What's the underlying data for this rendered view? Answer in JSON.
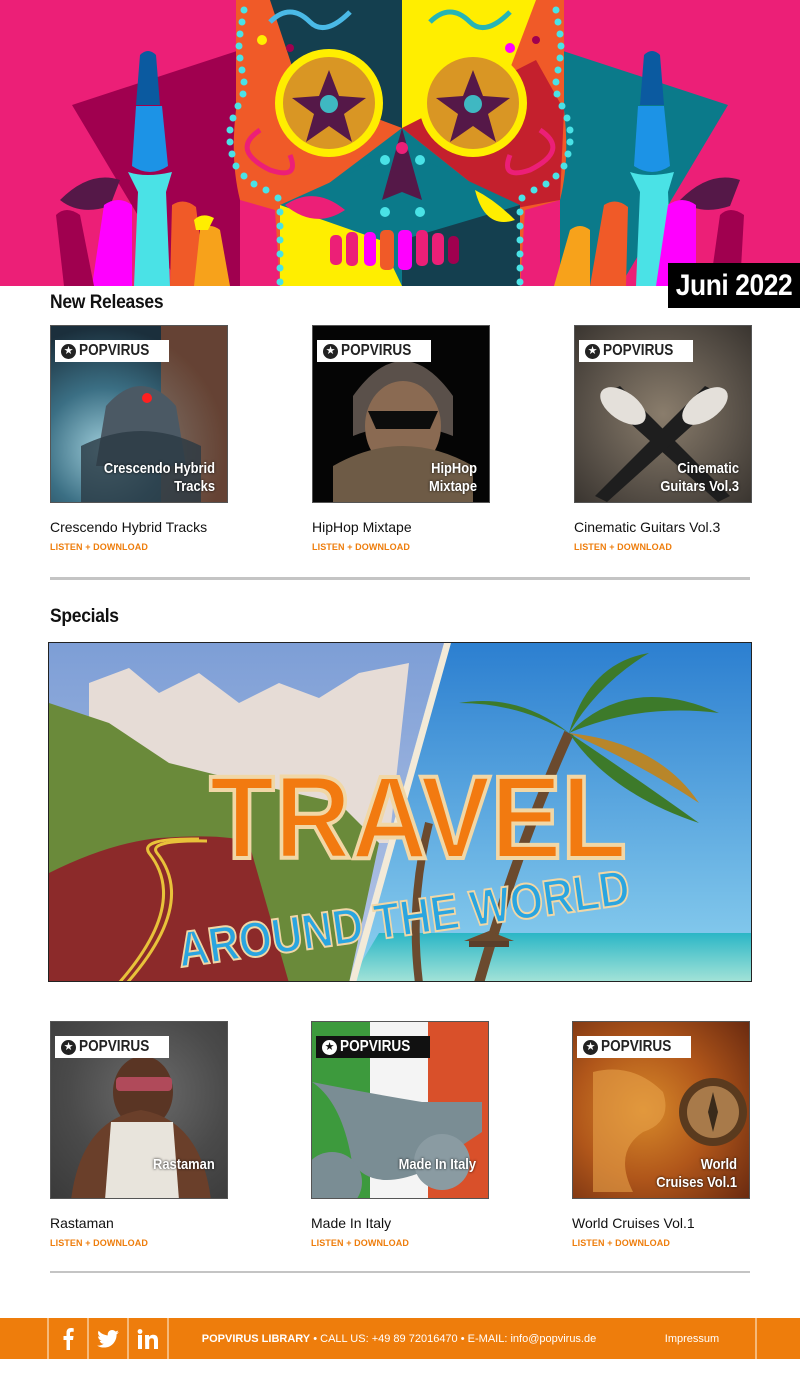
{
  "hero": {
    "issue_label": "Juni 2022",
    "colors": {
      "background": "#ec1f77",
      "accent": "#ee7d0c"
    }
  },
  "new_releases": {
    "title": "New Releases",
    "items": [
      {
        "title": "Crescendo Hybrid Tracks",
        "cover_text": "Crescendo Hybrid Tracks",
        "brand": "POPVIRUS",
        "link": "LISTEN + DOWNLOAD"
      },
      {
        "title": "HipHop Mixtape",
        "cover_text": "HipHop Mixtape",
        "brand": "POPVIRUS",
        "link": "LISTEN + DOWNLOAD"
      },
      {
        "title": "Cinematic Guitars Vol.3",
        "cover_text": "Cinematic Guitars Vol.3",
        "brand": "POPVIRUS",
        "link": "LISTEN + DOWNLOAD"
      }
    ]
  },
  "specials": {
    "title": "Specials",
    "banner": {
      "headline": "TRAVEL",
      "subline": "AROUND THE WORLD"
    },
    "items": [
      {
        "title": "Rastaman",
        "cover_text": "Rastaman",
        "brand": "POPVIRUS",
        "link": "LISTEN + DOWNLOAD"
      },
      {
        "title": "Made In Italy",
        "cover_text": "Made In Italy",
        "brand": "POPVIRUS",
        "link": "LISTEN + DOWNLOAD"
      },
      {
        "title": "World Cruises Vol.1",
        "cover_text": "World Cruises Vol.1",
        "brand": "POPVIRUS",
        "link": "LISTEN + DOWNLOAD"
      }
    ]
  },
  "footer": {
    "social": [
      {
        "name": "facebook",
        "icon": "facebook-icon"
      },
      {
        "name": "twitter",
        "icon": "twitter-icon"
      },
      {
        "name": "linkedin",
        "icon": "linkedin-icon"
      }
    ],
    "company": "POPVIRUS LIBRARY",
    "separator": "•",
    "phone_label": "CALL US:",
    "phone": "+49 89 72016470",
    "email_label": "E-MAIL:",
    "email": "info@popvirus.de",
    "imprint": "Impressum"
  }
}
